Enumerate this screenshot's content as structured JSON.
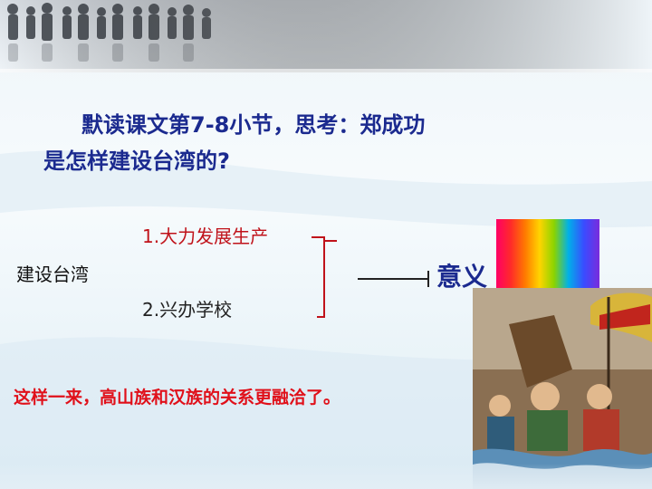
{
  "question": {
    "line1": "默读课文第7-8小节，思考：郑成功",
    "line2": "是怎样建设台湾的?"
  },
  "diagram": {
    "topic": "建设台湾",
    "item1": "1.大力发展生产",
    "item2": "2.兴办学校",
    "meaning": "意义"
  },
  "conclusion": "这样一来，高山族和汉族的关系更融洽了。"
}
